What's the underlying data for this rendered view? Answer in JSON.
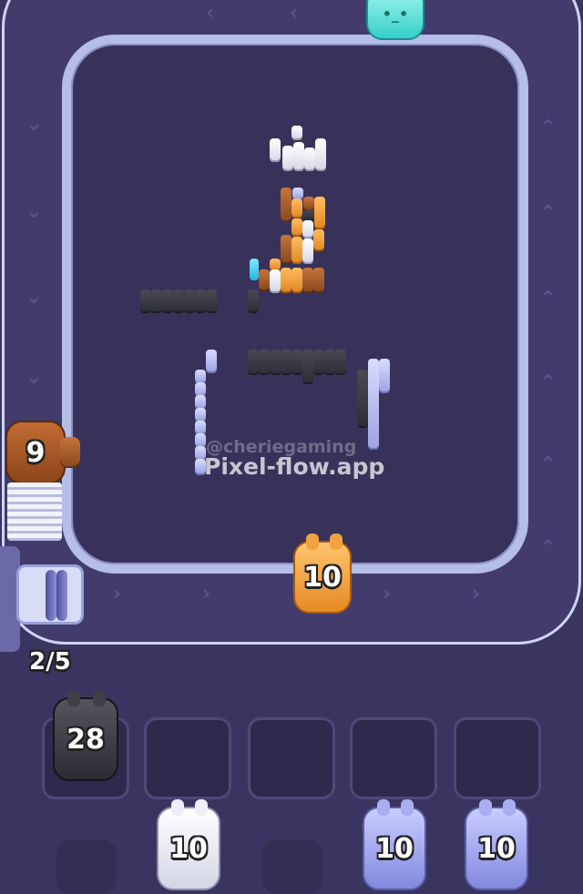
{
  "colors": {
    "background": "#3a3560",
    "track": "#423b6c",
    "track_border": "#cfd3f4",
    "board": "#38325b"
  },
  "counter": {
    "text": "2/5"
  },
  "watermark": {
    "handle": "@cheriegaming",
    "site": "Pixel-flow.app"
  },
  "conveyor_pigs": [
    {
      "color": "cyan",
      "count": ""
    },
    {
      "color": "brown",
      "count": "9"
    },
    {
      "color": "orange",
      "count": "10"
    }
  ],
  "slots": [
    {
      "filled": true,
      "color": "dark-gray",
      "count": "28"
    },
    {
      "filled": false
    },
    {
      "filled": false
    },
    {
      "filled": false
    },
    {
      "filled": false
    }
  ],
  "queue": [
    {
      "color": "white",
      "count": "10"
    },
    {
      "color": "lavender",
      "count": "10"
    },
    {
      "color": "lavender",
      "count": "10"
    }
  ]
}
